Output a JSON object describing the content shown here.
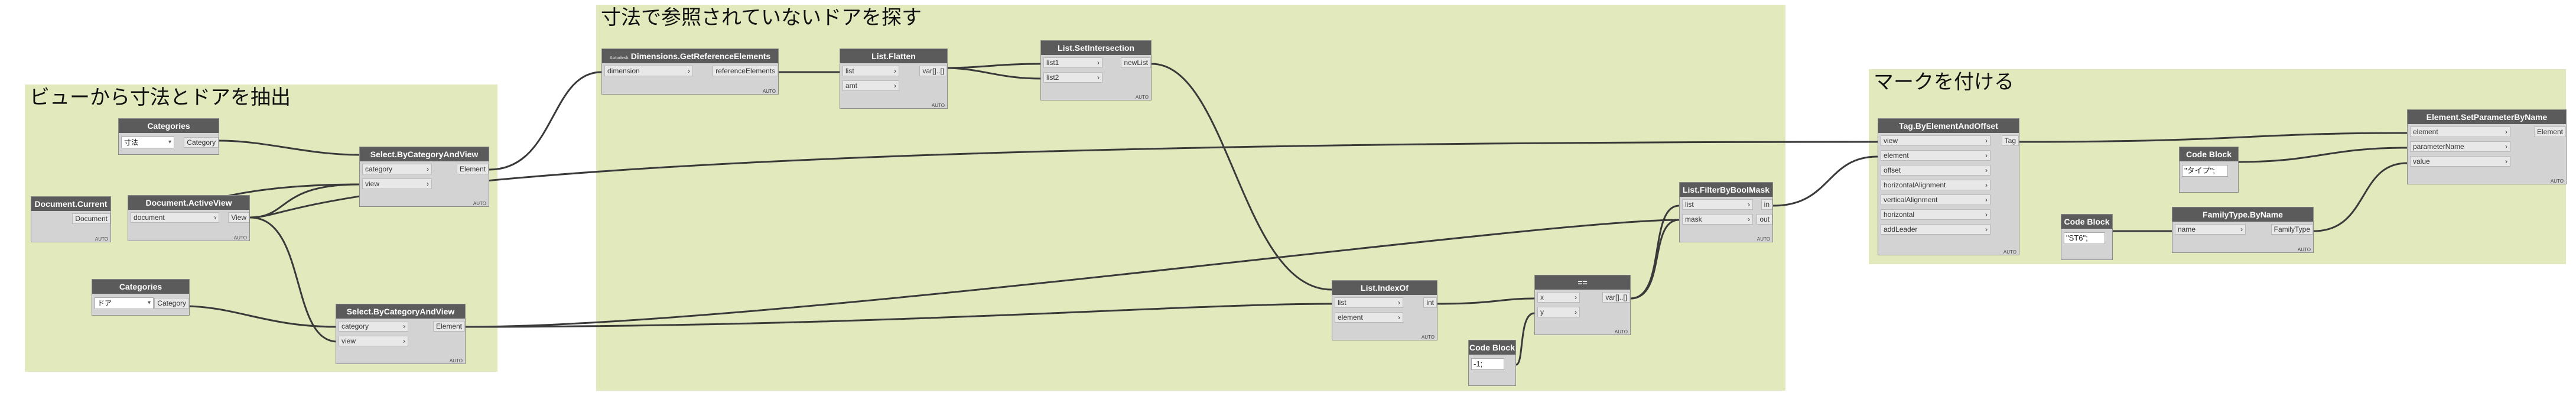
{
  "groups": [
    {
      "id": "g1",
      "title": "ビューから寸法とドアを抽出"
    },
    {
      "id": "g2",
      "title": "寸法で参照されていないドアを探す"
    },
    {
      "id": "g3",
      "title": "マークを付ける"
    }
  ],
  "nodes": {
    "categories1": {
      "title": "Categories",
      "dropdown": "寸法",
      "output": "Category"
    },
    "select1": {
      "title": "Select.ByCategoryAndView",
      "inputs": [
        "category",
        "view"
      ],
      "output": "Element",
      "lacing": "AUTO"
    },
    "doccurrent": {
      "title": "Document.Current",
      "output": "Document",
      "lacing": "AUTO"
    },
    "activeview": {
      "title": "Document.ActiveView",
      "input": "document",
      "output": "View",
      "lacing": "AUTO"
    },
    "categories2": {
      "title": "Categories",
      "dropdown": "ドア",
      "output": "Category"
    },
    "select2": {
      "title": "Select.ByCategoryAndView",
      "inputs": [
        "category",
        "view"
      ],
      "output": "Element",
      "lacing": "AUTO"
    },
    "getref": {
      "title": "Dimensions.GetReferenceElements",
      "badge": "Autodesk",
      "input": "dimension",
      "output": "referenceElements",
      "lacing": "AUTO"
    },
    "flatten": {
      "title": "List.Flatten",
      "inputs": [
        "list",
        "amt"
      ],
      "output": "var[]..[]",
      "lacing": "AUTO"
    },
    "setint": {
      "title": "List.SetIntersection",
      "inputs": [
        "list1",
        "list2"
      ],
      "output": "newList",
      "lacing": "AUTO"
    },
    "indexof": {
      "title": "List.IndexOf",
      "inputs": [
        "list",
        "element"
      ],
      "output": "int",
      "lacing": "AUTO"
    },
    "eq": {
      "title": "==",
      "inputs": [
        "x",
        "y"
      ],
      "output": "var[]..[]",
      "lacing": "AUTO"
    },
    "code1": {
      "title": "Code Block",
      "code": "-1;"
    },
    "filter": {
      "title": "List.FilterByBoolMask",
      "inputs": [
        "list",
        "mask"
      ],
      "outputs": [
        "in",
        "out"
      ],
      "lacing": "AUTO"
    },
    "tag": {
      "title": "Tag.ByElementAndOffset",
      "inputs": [
        "view",
        "element",
        "offset",
        "horizontalAlignment",
        "verticalAlignment",
        "horizontal",
        "addLeader"
      ],
      "output": "Tag",
      "lacing": "AUTO"
    },
    "code2": {
      "title": "Code Block",
      "code": "\"タイプ\";"
    },
    "code3": {
      "title": "Code Block",
      "code": "\"ST6\";"
    },
    "famtype": {
      "title": "FamilyType.ByName",
      "input": "name",
      "output": "FamilyType",
      "lacing": "AUTO"
    },
    "setparam": {
      "title": "Element.SetParameterByName",
      "inputs": [
        "element",
        "parameterName",
        "value"
      ],
      "output": "Element",
      "lacing": "AUTO"
    }
  },
  "colors": {
    "group_bg": "#e1e9bd",
    "node_header": "#5b5b5b",
    "node_body": "#d3d3d3",
    "wire": "#3a3a3a"
  }
}
